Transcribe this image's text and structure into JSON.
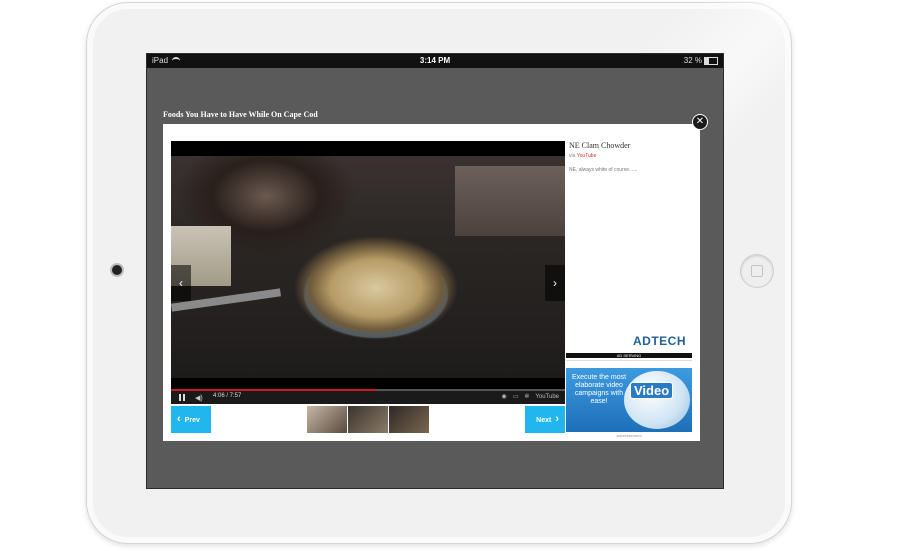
{
  "statusbar": {
    "device": "iPad",
    "time": "3:14 PM",
    "battery": "32 %",
    "battery_level": 0.32
  },
  "page": {
    "title": "Foods You Have to Have While On Cape Cod"
  },
  "modal": {
    "close_label": "✕",
    "video": {
      "current_time": "4:06",
      "duration": "7:57",
      "time_display": "4:06 / 7:57",
      "progress": 0.52,
      "prev_arrow": "‹",
      "next_arrow": "›",
      "youtube_badge": "YouTube"
    },
    "item": {
      "title": "NE Clam Chowder",
      "via_prefix": "via",
      "source": "YouTube",
      "description": "NE, always white of course......"
    },
    "ads": {
      "top_logo": "ADTECH",
      "top_strip": "AD SERVING",
      "main_text": "Execute the most elaborate video campaigns with ease!",
      "main_badge": "Video",
      "caption": "advertisement"
    },
    "nav": {
      "prev_label": "Prev",
      "next_label": "Next",
      "prev_arrow": "‹",
      "next_arrow": "›"
    }
  },
  "colors": {
    "accent": "#22b6ee",
    "progress": "#cc181e",
    "screen_bg": "#5a5a5a"
  }
}
